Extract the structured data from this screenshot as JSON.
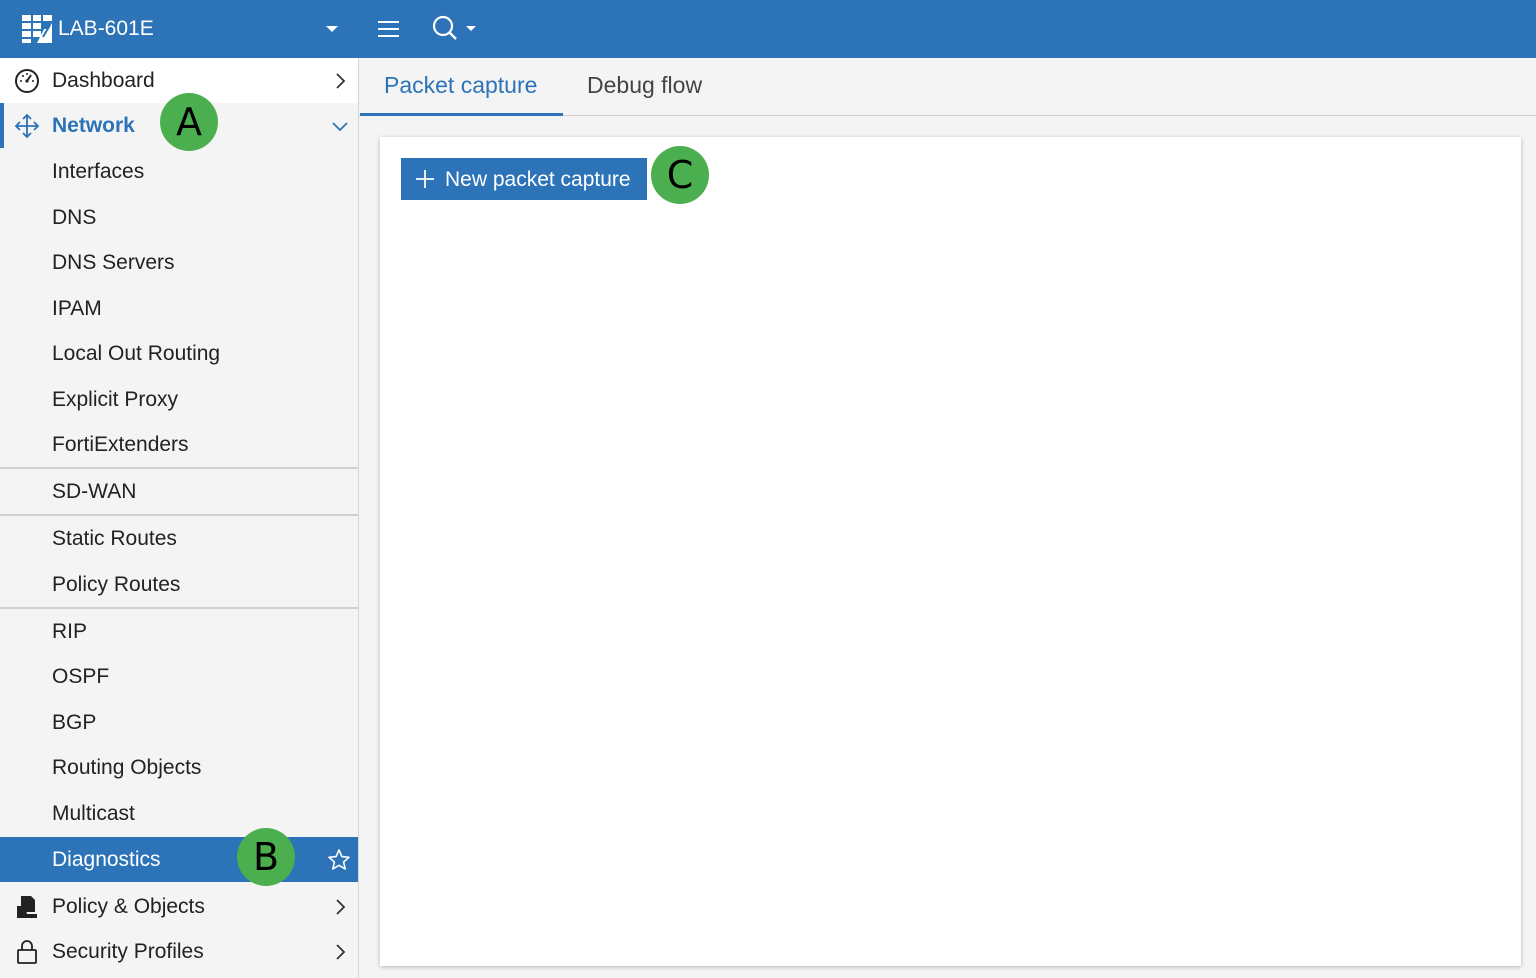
{
  "header": {
    "device_name": "LAB-601E",
    "icons": [
      "fortigate-logo-icon",
      "caret-down-icon",
      "hamburger-menu-icon",
      "search-icon"
    ]
  },
  "sidebar": {
    "dashboard": {
      "label": "Dashboard",
      "icon": "dashboard-gauge-icon"
    },
    "network": {
      "label": "Network",
      "icon": "network-arrows-icon",
      "expanded": true,
      "items": [
        {
          "label": "Interfaces"
        },
        {
          "label": "DNS"
        },
        {
          "label": "DNS Servers"
        },
        {
          "label": "IPAM"
        },
        {
          "label": "Local Out Routing"
        },
        {
          "label": "Explicit Proxy"
        },
        {
          "label": "FortiExtenders"
        },
        {
          "label": "SD-WAN"
        },
        {
          "label": "Static Routes"
        },
        {
          "label": "Policy Routes"
        },
        {
          "label": "RIP"
        },
        {
          "label": "OSPF"
        },
        {
          "label": "BGP"
        },
        {
          "label": "Routing Objects"
        },
        {
          "label": "Multicast"
        },
        {
          "label": "Diagnostics",
          "active": true
        }
      ]
    },
    "policy_objects": {
      "label": "Policy & Objects",
      "icon": "policy-document-icon"
    },
    "security_profiles": {
      "label": "Security Profiles",
      "icon": "lock-icon"
    }
  },
  "tabs": [
    {
      "label": "Packet capture",
      "active": true
    },
    {
      "label": "Debug flow",
      "active": false
    }
  ],
  "content": {
    "new_button_label": "New packet capture"
  },
  "annotations": {
    "a": "A",
    "b": "B",
    "c": "C"
  },
  "colors": {
    "accent": "#2d73b8",
    "badge": "#4caf4f",
    "sidebar_bg": "#f4f4f4"
  }
}
